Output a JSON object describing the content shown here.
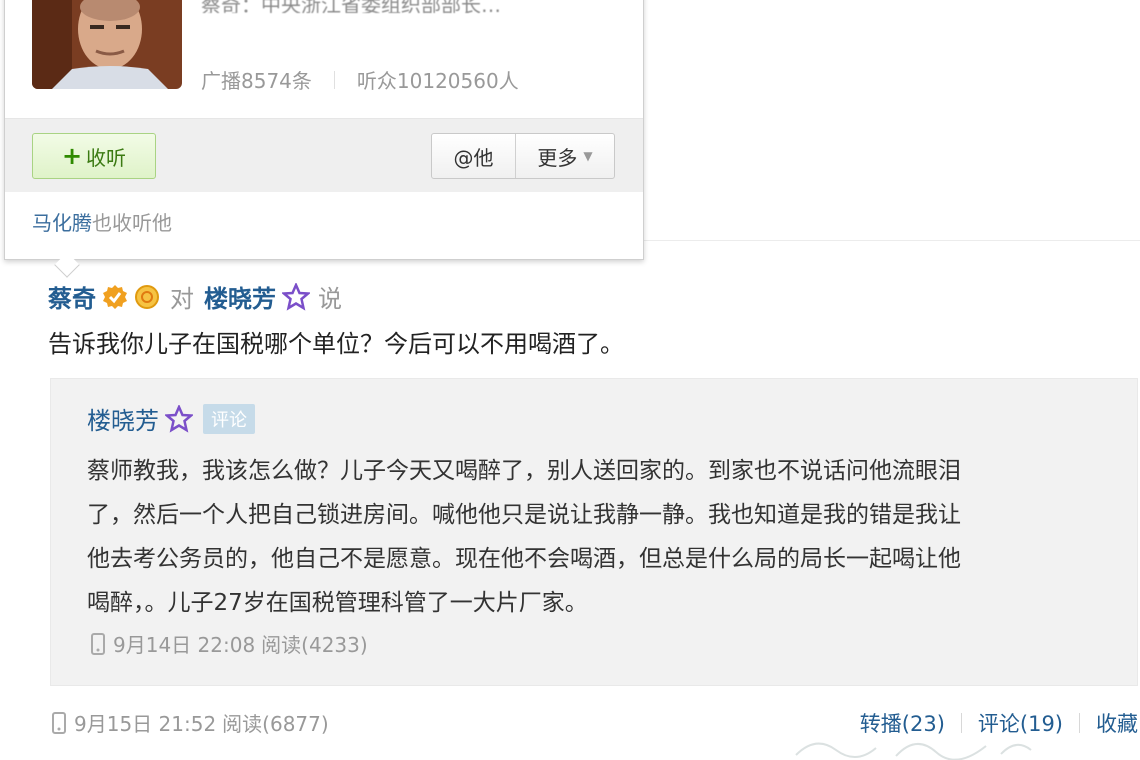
{
  "profile_card": {
    "bio_partial": "蔡奇：中央浙江省委组织部部长…",
    "stats": {
      "broadcasts": "广播8574条",
      "listeners": "听众10120560人"
    },
    "follow_label": "收听",
    "at_label": "@他",
    "more_label": "更多",
    "mutual": {
      "name": "马化腾",
      "suffix": "也收听他"
    }
  },
  "post": {
    "author": "蔡奇",
    "to_word": "对",
    "target": "楼晓芳",
    "say_word": "说",
    "text": "告诉我你儿子在国税哪个单位？今后可以不用喝酒了。",
    "quote": {
      "author": "楼晓芳",
      "tag": "评论",
      "lines": [
        "蔡师教我，我该怎么做？儿子今天又喝醉了，别人送回家的。到家也不说话问他流眼泪",
        "了，然后一个人把自己锁进房间。喊他他只是说让我静一静。我也知道是我的错是我让",
        "他去考公务员的，他自己不是愿意。现在他不会喝酒，但总是什么局的局长一起喝让他",
        "喝醉，。儿子27岁在国税管理科管了一大片厂家。"
      ],
      "date": "9月14日 22:08",
      "read": "阅读(4233)"
    },
    "date": "9月15日 21:52",
    "read": "阅读(6877)",
    "actions": {
      "repost": "转播(23)",
      "comment": "评论(19)",
      "favorite": "收藏"
    }
  },
  "colors": {
    "link": "#235d91",
    "follow_green": "#3b7a12",
    "tag_bg": "#c6dbe9",
    "verified": "#f0a020"
  },
  "icons": [
    "verified-icon",
    "vip-badge-icon",
    "star-icon",
    "phone-icon",
    "plus-icon",
    "caret-down-icon"
  ]
}
